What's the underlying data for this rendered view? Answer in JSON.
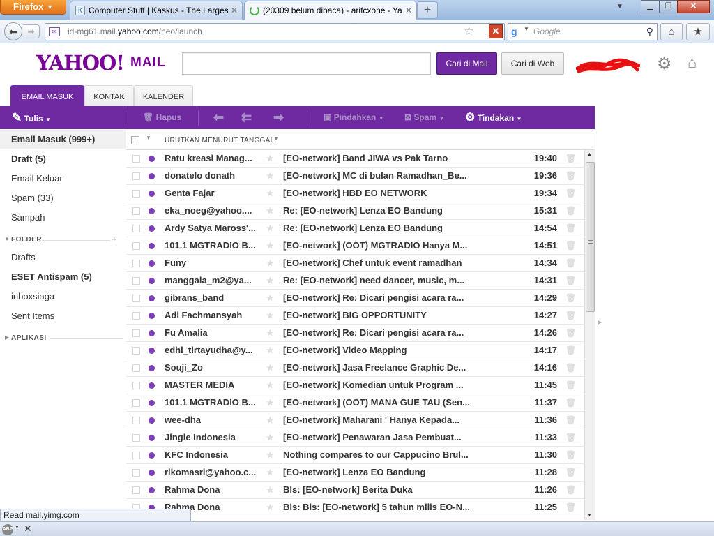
{
  "browser": {
    "menu_button": "Firefox",
    "tabs": [
      {
        "title": "Computer Stuff | Kaskus - The Larges...",
        "active": false
      },
      {
        "title": "(20309 belum dibaca) - arifcxone - Ya...",
        "active": true
      }
    ],
    "new_tab": "+",
    "url_host_prefix": "id-mg61.mail.",
    "url_host_main": "yahoo.com",
    "url_path": "/neo/launch",
    "search_engine_icon": "google-icon",
    "search_placeholder": "Google",
    "status_text": "Read mail.yimg.com"
  },
  "yahoo": {
    "logo": "YAHOO!",
    "logo_suffix": "MAIL",
    "search_value": "",
    "btn_mail": "Cari di Mail",
    "btn_web": "Cari di Web",
    "nav_tabs": [
      "EMAIL MASUK",
      "KONTAK",
      "KALENDER"
    ],
    "toolbar": {
      "compose": "Tulis",
      "delete": "Hapus",
      "move": "Pindahkan",
      "spam": "Spam",
      "actions": "Tindakan"
    },
    "sidebar": {
      "inbox": "Email Masuk (999+)",
      "draft": "Draft (5)",
      "sent": "Email Keluar",
      "spam": "Spam (33)",
      "trash": "Sampah",
      "folder_header": "FOLDER",
      "folders": [
        "Drafts",
        "ESET Antispam (5)",
        "inboxsiaga",
        "Sent Items"
      ],
      "apps_header": "APLIKASI"
    },
    "list_sort_label": "URUTKAN MENURUT TANGGAL",
    "messages": [
      {
        "from": "Ratu kreasi Manag...",
        "subject": "[EO-network] Band JIWA vs Pak Tarno",
        "time": "19:40"
      },
      {
        "from": "donatelo donath",
        "subject": "[EO-network] MC di bulan Ramadhan_Be...",
        "time": "19:36"
      },
      {
        "from": "Genta Fajar",
        "subject": "[EO-network] HBD EO NETWORK",
        "time": "19:34"
      },
      {
        "from": "eka_noeg@yahoo....",
        "subject": "Re: [EO-network] Lenza EO Bandung",
        "time": "15:31"
      },
      {
        "from": "Ardy Satya Maross'...",
        "subject": "Re: [EO-network] Lenza EO Bandung",
        "time": "14:54"
      },
      {
        "from": "101.1 MGTRADIO B...",
        "subject": "[EO-network] (OOT) MGTRADIO Hanya M...",
        "time": "14:51"
      },
      {
        "from": "Funy",
        "subject": "[EO-network] Chef untuk event ramadhan",
        "time": "14:34"
      },
      {
        "from": "manggala_m2@ya...",
        "subject": "Re: [EO-network] need dancer, music, m...",
        "time": "14:31"
      },
      {
        "from": "gibrans_band",
        "subject": "[EO-network] Re: Dicari pengisi acara ra...",
        "time": "14:29"
      },
      {
        "from": "Adi Fachmansyah",
        "subject": "[EO-network] BIG OPPORTUNITY",
        "time": "14:27"
      },
      {
        "from": "Fu Amalia",
        "subject": "[EO-network] Re: Dicari pengisi acara ra...",
        "time": "14:26"
      },
      {
        "from": "edhi_tirtayudha@y...",
        "subject": "[EO-network] Video Mapping",
        "time": "14:17"
      },
      {
        "from": "Souji_Zo",
        "subject": "[EO-network] Jasa Freelance Graphic De...",
        "time": "14:16"
      },
      {
        "from": "MASTER MEDIA",
        "subject": "[EO-network] Komedian untuk Program ...",
        "time": "11:45"
      },
      {
        "from": "101.1 MGTRADIO B...",
        "subject": "[EO-network] (OOT) MANA GUE TAU (Sen...",
        "time": "11:37"
      },
      {
        "from": "wee-dha",
        "subject": "[EO-network] Maharani ' Hanya Kepada...",
        "time": "11:36"
      },
      {
        "from": "Jingle Indonesia",
        "subject": "[EO-network] Penawaran Jasa Pembuat...",
        "time": "11:33"
      },
      {
        "from": "KFC Indonesia",
        "subject": "Nothing compares to our Cappucino Brul...",
        "time": "11:30"
      },
      {
        "from": "rikomasri@yahoo.c...",
        "subject": "[EO-network] Lenza EO Bandung",
        "time": "11:28"
      },
      {
        "from": "Rahma Dona",
        "subject": "Bls: [EO-network] Berita Duka",
        "time": "11:26"
      },
      {
        "from": "Rahma Dona",
        "subject": "Bls: Bls: [EO-network] 5 tahun milis EO-N...",
        "time": "11:25"
      }
    ]
  },
  "colors": {
    "brand": "#6f2aa2",
    "unread_dot": "#7c3fb8"
  }
}
